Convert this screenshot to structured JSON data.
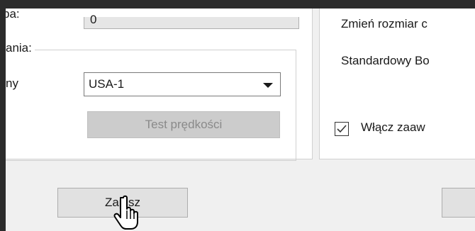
{
  "left_panel": {
    "field_label_partial": "ba:",
    "field_value_partial": "0",
    "group_legend_partial": "ania:",
    "server_label_partial": "ny",
    "server_select_value": "USA-1",
    "speed_test_button": "Test prędkości"
  },
  "right_panel": {
    "resize_label_partial": "Zmień rozmiar c",
    "default_label_partial": "Standardowy Bo",
    "advanced_checkbox_label_partial": "Włącz zaaw",
    "advanced_checkbox_checked": true
  },
  "footer": {
    "save_button": "Zapisz"
  }
}
